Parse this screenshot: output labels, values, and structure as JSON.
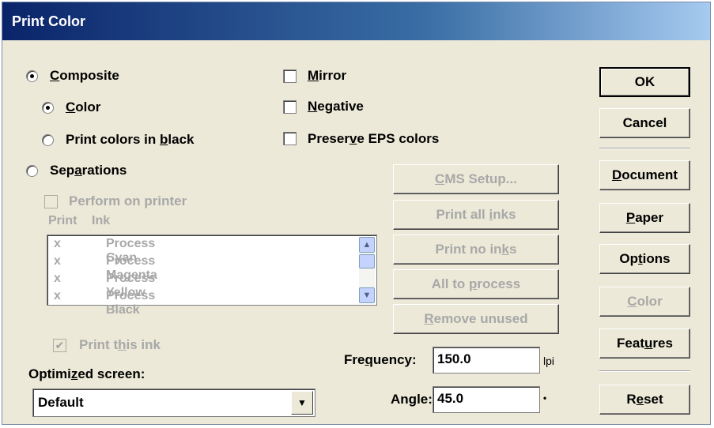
{
  "window": {
    "title": "Print Color"
  },
  "output_mode": {
    "composite": {
      "pre": "",
      "u": "C",
      "post": "omposite",
      "checked": true
    },
    "color": {
      "pre": "",
      "u": "C",
      "post": "olor",
      "checked": true
    },
    "black": {
      "pre": "Print colors in ",
      "u": "b",
      "post": "lack",
      "checked": false
    },
    "separations": {
      "pre": "Sep",
      "u": "a",
      "post": "rations",
      "checked": false
    }
  },
  "options": {
    "mirror": {
      "pre": "",
      "u": "M",
      "post": "irror",
      "checked": false
    },
    "negative": {
      "pre": "",
      "u": "N",
      "post": "egative",
      "checked": false
    },
    "preserve_eps": {
      "pre": "Preser",
      "u": "v",
      "post": "e EPS colors",
      "checked": false
    }
  },
  "perform_on_printer": {
    "label": "Perform on printer",
    "checked": false
  },
  "ink_list": {
    "headers": {
      "print": "Print",
      "ink": "Ink"
    },
    "items": [
      {
        "print": "x",
        "ink": "Process Cyan"
      },
      {
        "print": "x",
        "ink": "Process Magenta"
      },
      {
        "print": "x",
        "ink": "Process Yellow"
      },
      {
        "print": "x",
        "ink": "Process Black"
      }
    ]
  },
  "print_this_ink": {
    "pre": "Print t",
    "u": "h",
    "post": "is ink",
    "checked": true
  },
  "ink_buttons": {
    "cms_setup": {
      "pre": "",
      "u": "C",
      "post": "MS Setup..."
    },
    "print_all": {
      "pre": "Print all ",
      "u": "i",
      "post": "nks"
    },
    "print_none": {
      "pre": "Print no in",
      "u": "k",
      "post": "s"
    },
    "all_to_process": {
      "pre": "All to ",
      "u": "p",
      "post": "rocess"
    },
    "remove_unused": {
      "pre": "",
      "u": "R",
      "post": "emove unused"
    }
  },
  "screen": {
    "label_pre": "Optimi",
    "label_u": "z",
    "label_post": "ed screen:",
    "value": "Default",
    "frequency_pre": "Fre",
    "frequency_u": "q",
    "frequency_post": "uency:",
    "frequency": "150.0",
    "frequency_unit": "lpi",
    "angle_pre": "An",
    "angle_u": "g",
    "angle_post": "le:",
    "angle": "45.0",
    "angle_unit": "•"
  },
  "side_buttons": {
    "ok": {
      "pre": "OK",
      "u": "",
      "post": ""
    },
    "cancel": {
      "pre": "Cancel",
      "u": "",
      "post": ""
    },
    "document": {
      "pre": "",
      "u": "D",
      "post": "ocument"
    },
    "paper": {
      "pre": "",
      "u": "P",
      "post": "aper"
    },
    "options": {
      "pre": "Op",
      "u": "t",
      "post": "ions"
    },
    "color": {
      "pre": "",
      "u": "C",
      "post": "olor"
    },
    "features": {
      "pre": "Feat",
      "u": "u",
      "post": "res"
    },
    "reset": {
      "pre": "R",
      "u": "e",
      "post": "set"
    }
  },
  "colors": {
    "title_bar": "#0a246a",
    "face": "#ece9d8",
    "disabled_text": "#a8a8a8"
  }
}
